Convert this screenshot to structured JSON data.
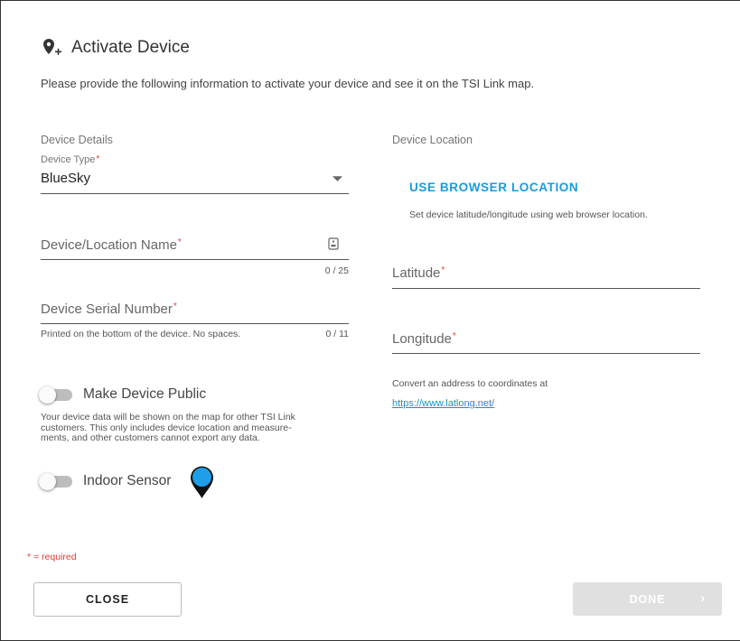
{
  "dialog": {
    "title": "Activate Device",
    "subtitle": "Please provide the following information to activate your device and see it on the TSI Link map."
  },
  "details": {
    "heading": "Device Details",
    "device_type_label": "Device Type",
    "device_type_value": "BlueSky",
    "name_label": "Device/Location Name",
    "name_counter": "0 / 25",
    "serial_label": "Device Serial Number",
    "serial_hint": "Printed on the bottom of the device. No spaces.",
    "serial_counter": "0 / 11",
    "public_toggle_label": "Make Device Public",
    "public_desc_1": "Your device data will be shown on the map for other TSI Link",
    "public_desc_2": "customers. This only includes device location and measure-",
    "public_desc_3": "ments, and other customers cannot export any data.",
    "indoor_toggle_label": "Indoor Sensor",
    "required_star": "*"
  },
  "location": {
    "heading": "Device Location",
    "browser_button": "USE BROWSER LOCATION",
    "browser_desc": "Set device latitude/longitude using web browser location.",
    "latitude_label": "Latitude",
    "longitude_label": "Longitude",
    "convert_text": "Convert an address to coordinates at",
    "convert_link": "https://www.latlong.net/"
  },
  "footer": {
    "required_note": "* = required",
    "close_label": "CLOSE",
    "done_label": "DONE",
    "done_chevron": "›"
  },
  "colors": {
    "accent": "#1a9bdc",
    "required": "#e53935",
    "pin_fill": "#1e9fe8",
    "pin_outline": "#111111"
  },
  "icons": {
    "title_icon": "add-location-icon",
    "dropdown_icon": "caret-down-icon",
    "name_field_icon": "badge-icon",
    "indoor_icon": "map-pin-icon"
  }
}
